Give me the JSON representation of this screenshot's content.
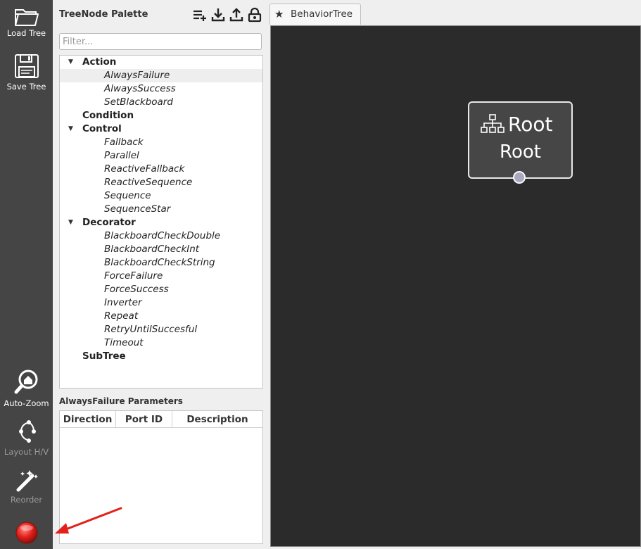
{
  "toolbar": {
    "load": "Load Tree",
    "save": "Save Tree",
    "autozoom": "Auto-Zoom",
    "layout": "Layout H/V",
    "reorder": "Reorder",
    "record_icon": "record-button-icon",
    "accent_red": "#e3201c"
  },
  "palette": {
    "title": "TreeNode Palette",
    "icons": [
      "add-list-icon",
      "download-icon",
      "upload-icon",
      "lock-icon"
    ],
    "filter_placeholder": "Filter...",
    "tree": [
      {
        "label": "Action",
        "kind": "cat",
        "expanded": true
      },
      {
        "label": "AlwaysFailure",
        "kind": "item",
        "selected": true
      },
      {
        "label": "AlwaysSuccess",
        "kind": "item"
      },
      {
        "label": "SetBlackboard",
        "kind": "item"
      },
      {
        "label": "Condition",
        "kind": "cat",
        "expanded": false
      },
      {
        "label": "Control",
        "kind": "cat",
        "expanded": true
      },
      {
        "label": "Fallback",
        "kind": "item"
      },
      {
        "label": "Parallel",
        "kind": "item"
      },
      {
        "label": "ReactiveFallback",
        "kind": "item"
      },
      {
        "label": "ReactiveSequence",
        "kind": "item"
      },
      {
        "label": "Sequence",
        "kind": "item"
      },
      {
        "label": "SequenceStar",
        "kind": "item"
      },
      {
        "label": "Decorator",
        "kind": "cat",
        "expanded": true
      },
      {
        "label": "BlackboardCheckDouble",
        "kind": "item"
      },
      {
        "label": "BlackboardCheckInt",
        "kind": "item"
      },
      {
        "label": "BlackboardCheckString",
        "kind": "item"
      },
      {
        "label": "ForceFailure",
        "kind": "item"
      },
      {
        "label": "ForceSuccess",
        "kind": "item"
      },
      {
        "label": "Inverter",
        "kind": "item"
      },
      {
        "label": "Repeat",
        "kind": "item"
      },
      {
        "label": "RetryUntilSuccesful",
        "kind": "item"
      },
      {
        "label": "Timeout",
        "kind": "item"
      },
      {
        "label": "SubTree",
        "kind": "cat",
        "expanded": false
      }
    ],
    "params_title": "AlwaysFailure Parameters",
    "columns": [
      "Direction",
      "Port ID",
      "Description"
    ]
  },
  "editor": {
    "tab_label": "BehaviorTree",
    "root_title": "Root",
    "root_name": "Root",
    "canvas_color": "#2b2b2b"
  }
}
